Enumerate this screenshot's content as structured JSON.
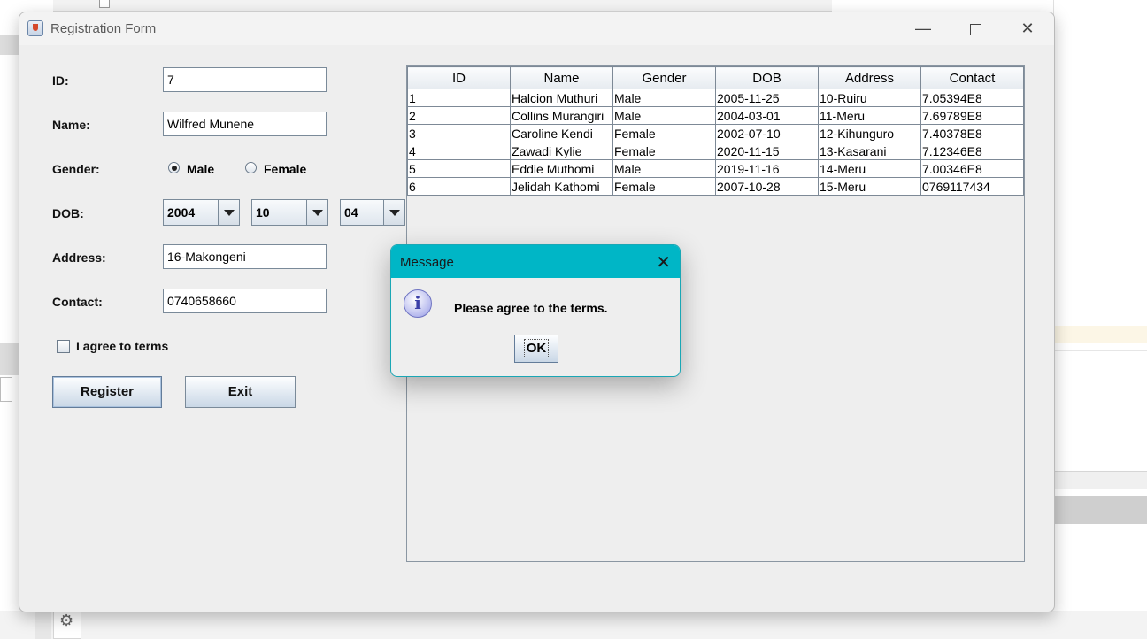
{
  "window": {
    "title": "Registration Form"
  },
  "form": {
    "id_label": "ID:",
    "id_value": "7",
    "name_label": "Name:",
    "name_value": "Wilfred Munene",
    "gender_label": "Gender:",
    "gender_options": [
      "Male",
      "Female"
    ],
    "gender_selected": "Male",
    "dob_label": "DOB:",
    "dob_year": "2004",
    "dob_month": "10",
    "dob_day": "04",
    "address_label": "Address:",
    "address_value": "16-Makongeni",
    "contact_label": "Contact:",
    "contact_value": "0740658660",
    "terms_label": "I agree to terms",
    "terms_checked": false,
    "register_label": "Register",
    "exit_label": "Exit"
  },
  "table": {
    "columns": [
      "ID",
      "Name",
      "Gender",
      "DOB",
      "Address",
      "Contact"
    ],
    "rows": [
      [
        "1",
        "Halcion Muthuri",
        "Male",
        "2005-11-25",
        "10-Ruiru",
        "7.05394E8"
      ],
      [
        "2",
        "Collins Murangiri",
        "Male",
        "2004-03-01",
        "11-Meru",
        "7.69789E8"
      ],
      [
        "3",
        "Caroline Kendi",
        "Female",
        "2002-07-10",
        "12-Kihunguro",
        "7.40378E8"
      ],
      [
        "4",
        "Zawadi Kylie",
        "Female",
        "2020-11-15",
        "13-Kasarani",
        "7.12346E8"
      ],
      [
        "5",
        "Eddie Muthomi",
        "Male",
        "2019-11-16",
        "14-Meru",
        "7.00346E8"
      ],
      [
        "6",
        "Jelidah Kathomi",
        "Female",
        "2007-10-28",
        "15-Meru",
        "0769117434"
      ]
    ]
  },
  "dialog": {
    "title": "Message",
    "message": "Please agree to the terms.",
    "ok_label": "OK",
    "icon": "info-icon"
  },
  "colors": {
    "dialog_titlebar": "#00b6c6",
    "window_bg": "#eeeeee"
  }
}
